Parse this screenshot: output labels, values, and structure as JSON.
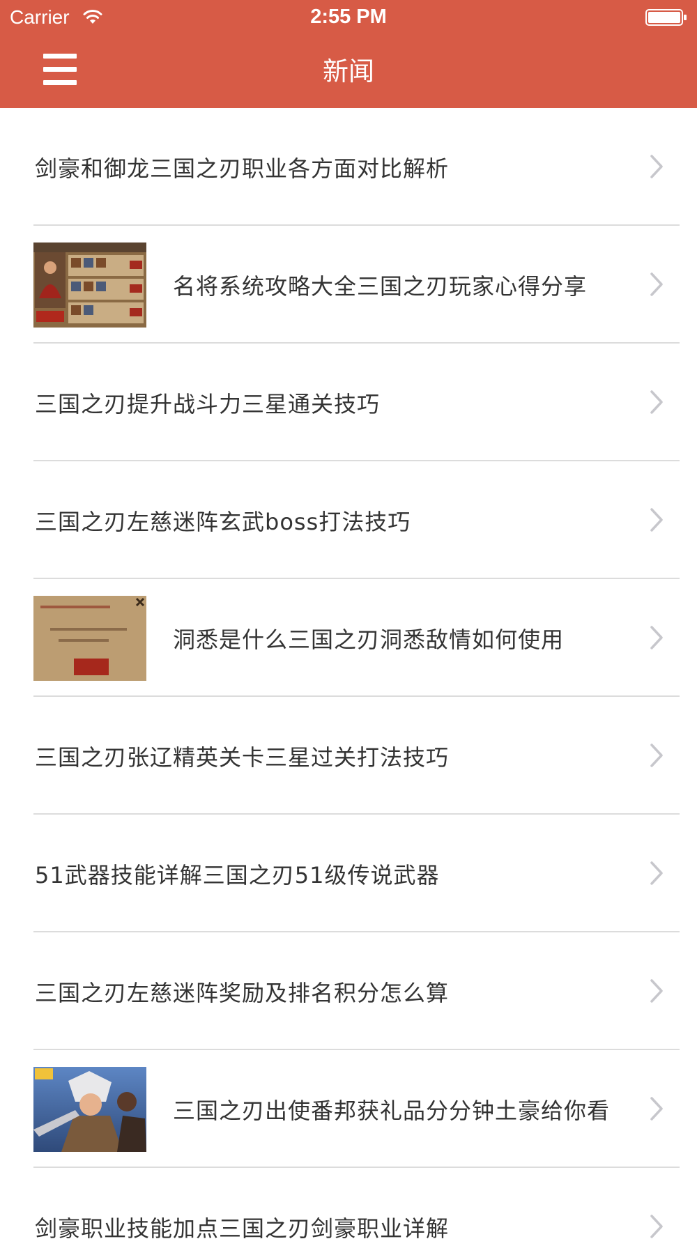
{
  "status_bar": {
    "carrier": "Carrier",
    "time": "2:55 PM"
  },
  "nav": {
    "title": "新闻",
    "menu_icon": "hamburger-menu-icon",
    "background_color": "#d75b46"
  },
  "news": [
    {
      "title": "剑豪和御龙三国之刃职业各方面对比解析"
    },
    {
      "title": "名将系统攻略大全三国之刃玩家心得分享",
      "thumbnail": "game-screenshot-generals-roster"
    },
    {
      "title": "三国之刃提升战斗力三星通关技巧"
    },
    {
      "title": "三国之刃左慈迷阵玄武boss打法技巧"
    },
    {
      "title": "洞悉是什么三国之刃洞悉敌情如何使用",
      "thumbnail": "game-dialog-insight"
    },
    {
      "title": "三国之刃张辽精英关卡三星过关打法技巧"
    },
    {
      "title": "51武器技能详解三国之刃51级传说武器"
    },
    {
      "title": "三国之刃左慈迷阵奖励及排名积分怎么算"
    },
    {
      "title": "三国之刃出使番邦获礼品分分钟土豪给你看",
      "thumbnail": "game-hero-artwork"
    },
    {
      "title": "剑豪职业技能加点三国之刃剑豪职业详解"
    }
  ]
}
